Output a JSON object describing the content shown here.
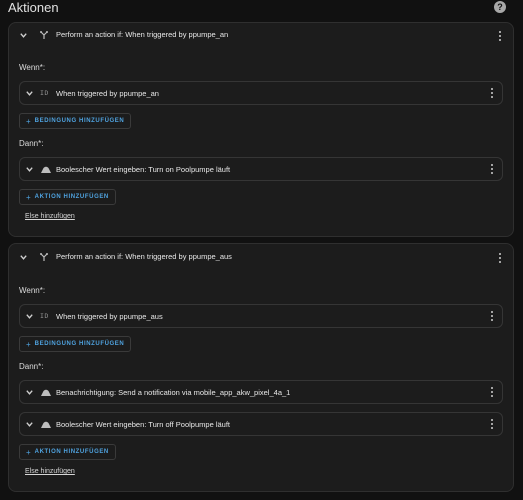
{
  "page": {
    "title": "Aktionen",
    "help_icon": "help-circle-icon"
  },
  "labels": {
    "wenn": "Wenn*:",
    "dann": "Dann*:",
    "add_condition": "BEDINGUNG HINZUFÜGEN",
    "add_action": "AKTION HINZUFÜGEN",
    "else_link": "Else hinzufügen",
    "id_glyph": "ID"
  },
  "cards": [
    {
      "title": "Perform an action if: When triggered by ppumpe_an",
      "conditions": [
        {
          "title": "When triggered by ppumpe_an"
        }
      ],
      "actions": [
        {
          "title": "Boolescher Wert eingeben: Turn on Poolpumpe läuft"
        }
      ]
    },
    {
      "title": "Perform an action if: When triggered by ppumpe_aus",
      "conditions": [
        {
          "title": "When triggered by ppumpe_aus"
        }
      ],
      "actions": [
        {
          "title": "Benachrichtigung: Send a notification via mobile_app_akw_pixel_4a_1"
        },
        {
          "title": "Boolescher Wert eingeben: Turn off Poolpumpe läuft"
        }
      ]
    }
  ],
  "colors": {
    "accent": "#4fa3e0",
    "background": "#111111",
    "card": "#1c1c1c"
  }
}
